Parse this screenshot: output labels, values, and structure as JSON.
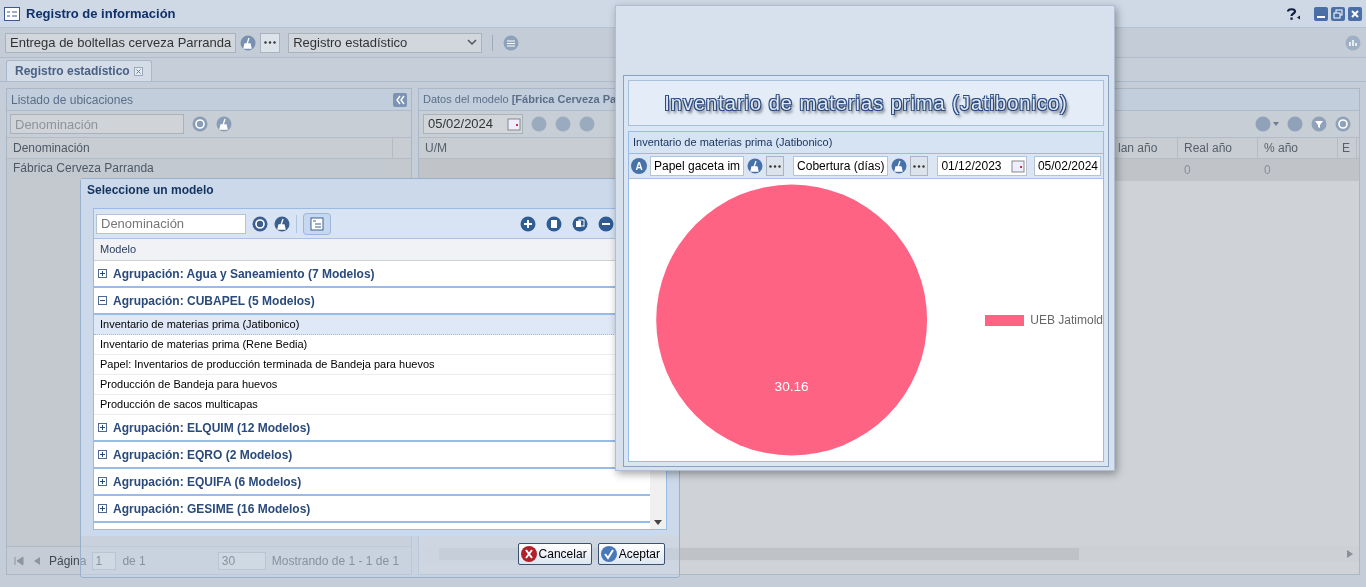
{
  "window": {
    "title": "Registro de información"
  },
  "toolbar": {
    "entity_combo": "Entrega de boltellas cerveza Parranda",
    "type_combo": "Registro estadístico"
  },
  "tabs": [
    {
      "label": "Registro estadístico",
      "selected": true
    }
  ],
  "locations_panel": {
    "title": "Listado de ubicaciones",
    "search": {
      "placeholder": "Denominación"
    },
    "columns": [
      "Denominación"
    ],
    "rows": [
      "Fábrica Cerveza Parranda"
    ],
    "paging": {
      "page_label": "Página",
      "page": "1",
      "of": "de 1",
      "page_size": "30",
      "summary": "Mostrando de 1 - 1 de 1"
    }
  },
  "model_panel": {
    "title": "Datos del modelo **[Fábrica Cerveza Pa**",
    "date": "05/02/2024",
    "columns": [
      {
        "label": "U/M"
      },
      {
        "label": "lan año"
      },
      {
        "label": "Real año",
        "value": "0"
      },
      {
        "label": "% año",
        "value": "0"
      },
      {
        "label": "E"
      }
    ]
  },
  "model_dialog": {
    "title": "Seleccione un modelo",
    "search": {
      "placeholder": "Denominación"
    },
    "column": "Modelo",
    "groups": [
      {
        "label": "Agrupación: Agua y Saneamiento (7 Modelos)",
        "expanded": false
      },
      {
        "label": "Agrupación: CUBAPEL (5 Modelos)",
        "expanded": true,
        "children": [
          {
            "label": "Inventario de materias prima (Jatibonico)",
            "selected": true
          },
          {
            "label": "Inventario de materias prima (Rene Bedia)",
            "selected": false
          },
          {
            "label": "Papel: Inventarios de producción terminada de Bandeja para huevos",
            "selected": false
          },
          {
            "label": "Producción de Bandeja para huevos",
            "selected": false
          },
          {
            "label": "Producción de sacos multicapas",
            "selected": false
          }
        ]
      },
      {
        "label": "Agrupación: ELQUIM (12 Modelos)",
        "expanded": false
      },
      {
        "label": "Agrupación: EQRO (2 Modelos)",
        "expanded": false
      },
      {
        "label": "Agrupación: EQUIFA (6 Modelos)",
        "expanded": false
      },
      {
        "label": "Agrupación: GESIME (16 Modelos)",
        "expanded": false
      }
    ],
    "buttons": [
      {
        "label": "Cancelar",
        "kind": "cancel"
      },
      {
        "label": "Aceptar",
        "kind": "accept"
      }
    ]
  },
  "chart_window": {
    "title": "Inventario de materias prima (Jatibonico)",
    "panel_title": "Inventario de materias prima (Jatibonico)",
    "mode_icon_label": "A",
    "product_field": "Papel gaceta im",
    "indicator_field": "Cobertura (días)",
    "date_from": "01/12/2023",
    "date_to": "05/02/2024",
    "chart_data": {
      "type": "pie",
      "categories": [
        "UEB Jatimold"
      ],
      "series": [
        {
          "color": "#ff6384",
          "values": [
            30.16
          ]
        }
      ],
      "data_labels": true
    }
  }
}
